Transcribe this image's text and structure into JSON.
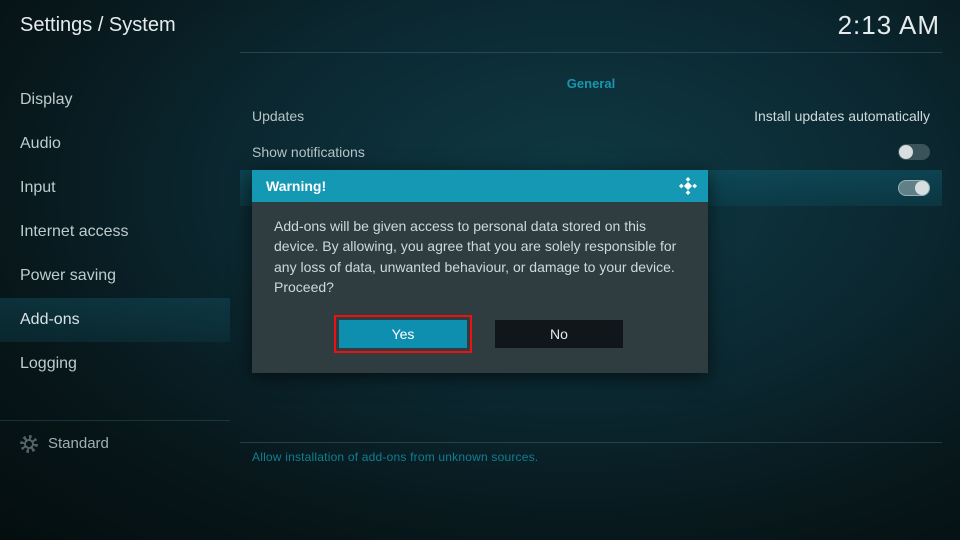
{
  "header": {
    "breadcrumb": "Settings / System",
    "clock": "2:13 AM"
  },
  "sidebar": {
    "items": [
      {
        "label": "Display"
      },
      {
        "label": "Audio"
      },
      {
        "label": "Input"
      },
      {
        "label": "Internet access"
      },
      {
        "label": "Power saving"
      },
      {
        "label": "Add-ons"
      },
      {
        "label": "Logging"
      }
    ],
    "selected_index": 5
  },
  "level": {
    "label": "Standard"
  },
  "content": {
    "section_title": "General",
    "rows": [
      {
        "label": "Updates",
        "value": "Install updates automatically"
      },
      {
        "label": "Show notifications",
        "toggle": "off"
      },
      {
        "label": "",
        "spacer_highlight": true,
        "toggle": "on"
      }
    ],
    "help_text": "Allow installation of add-ons from unknown sources."
  },
  "modal": {
    "title": "Warning!",
    "body": "Add-ons will be given access to personal data stored on this device. By allowing, you agree that you are solely responsible for any loss of data, unwanted behaviour, or damage to your device. Proceed?",
    "yes_label": "Yes",
    "no_label": "No"
  }
}
